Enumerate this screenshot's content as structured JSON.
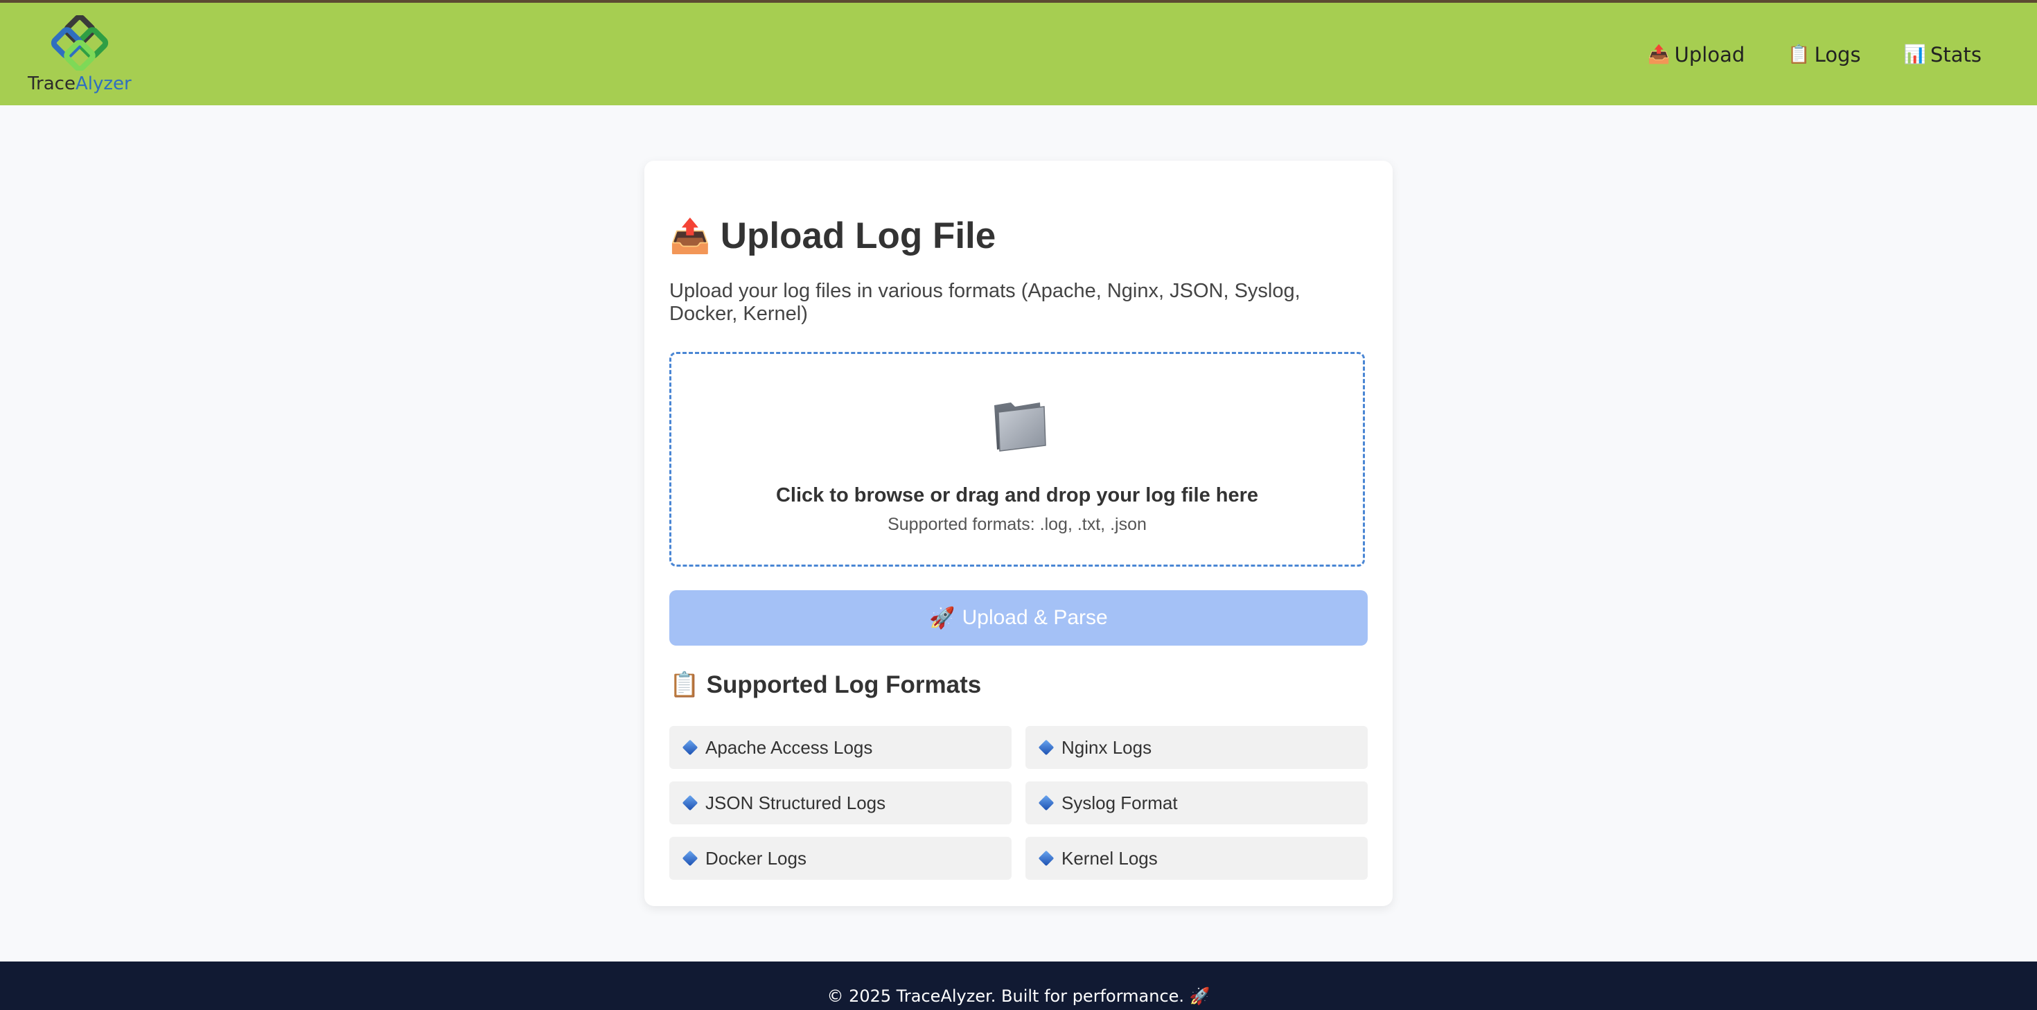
{
  "header": {
    "logo": {
      "name_part1": "Trace",
      "name_part2": "Alyzer"
    },
    "nav": [
      {
        "icon": "📤",
        "label": "Upload"
      },
      {
        "icon": "📋",
        "label": "Logs"
      },
      {
        "icon": "📊",
        "label": "Stats"
      }
    ]
  },
  "upload_card": {
    "title_icon": "📤",
    "title": "Upload Log File",
    "description": "Upload your log files in various formats (Apache, Nginx, JSON, Syslog, Docker, Kernel)",
    "dropzone": {
      "icon": "folder-icon",
      "main_text": "Click to browse or drag and drop your log file here",
      "sub_text": "Supported formats: .log, .txt, .json"
    },
    "button": {
      "icon": "🚀",
      "label": "Upload & Parse"
    },
    "formats_title_icon": "📋",
    "formats_title": "Supported Log Formats",
    "formats": [
      "Apache Access Logs",
      "Nginx Logs",
      "JSON Structured Logs",
      "Syslog Format",
      "Docker Logs",
      "Kernel Logs"
    ]
  },
  "footer": {
    "text": "© 2025 TraceAlyzer. Built for performance. 🚀"
  },
  "colors": {
    "header_bg": "#a6ce51",
    "accent_blue": "#4a86d4",
    "button_bg": "#a4c1f6",
    "footer_bg": "#111a33"
  }
}
